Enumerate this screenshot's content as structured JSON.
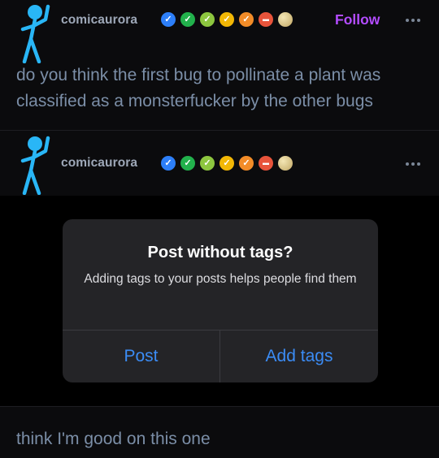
{
  "post1": {
    "username": "comicaurora",
    "follow_label": "Follow",
    "text": "do you think the first bug to pollinate a plant was classified as a monsterfucker by the other bugs"
  },
  "post2": {
    "username": "comicaurora"
  },
  "badges": [
    {
      "icon": "verified-check-icon",
      "color": "#2d7ff9",
      "glyph": "✓"
    },
    {
      "icon": "verified-check-icon",
      "color": "#22b14c",
      "glyph": "✓"
    },
    {
      "icon": "verified-check-icon",
      "color": "#8dc63f",
      "glyph": "✓"
    },
    {
      "icon": "verified-check-icon",
      "color": "#f2b705",
      "glyph": "✓"
    },
    {
      "icon": "verified-check-icon",
      "color": "#f28c28",
      "glyph": "✓"
    },
    {
      "icon": "ticket-badge-icon",
      "color": "#e8543b",
      "glyph": "▬"
    },
    {
      "icon": "moon-icon",
      "color": "#d9c58a",
      "glyph": ""
    }
  ],
  "dialog": {
    "title": "Post without tags?",
    "message": "Adding tags to your posts helps people find them",
    "post_label": "Post",
    "add_tags_label": "Add tags"
  },
  "reply": {
    "text": "think I'm good on this one"
  },
  "colors": {
    "accent_follow": "#b34cff",
    "dialog_button": "#3b8cf5",
    "avatar": "#29b6f6"
  }
}
